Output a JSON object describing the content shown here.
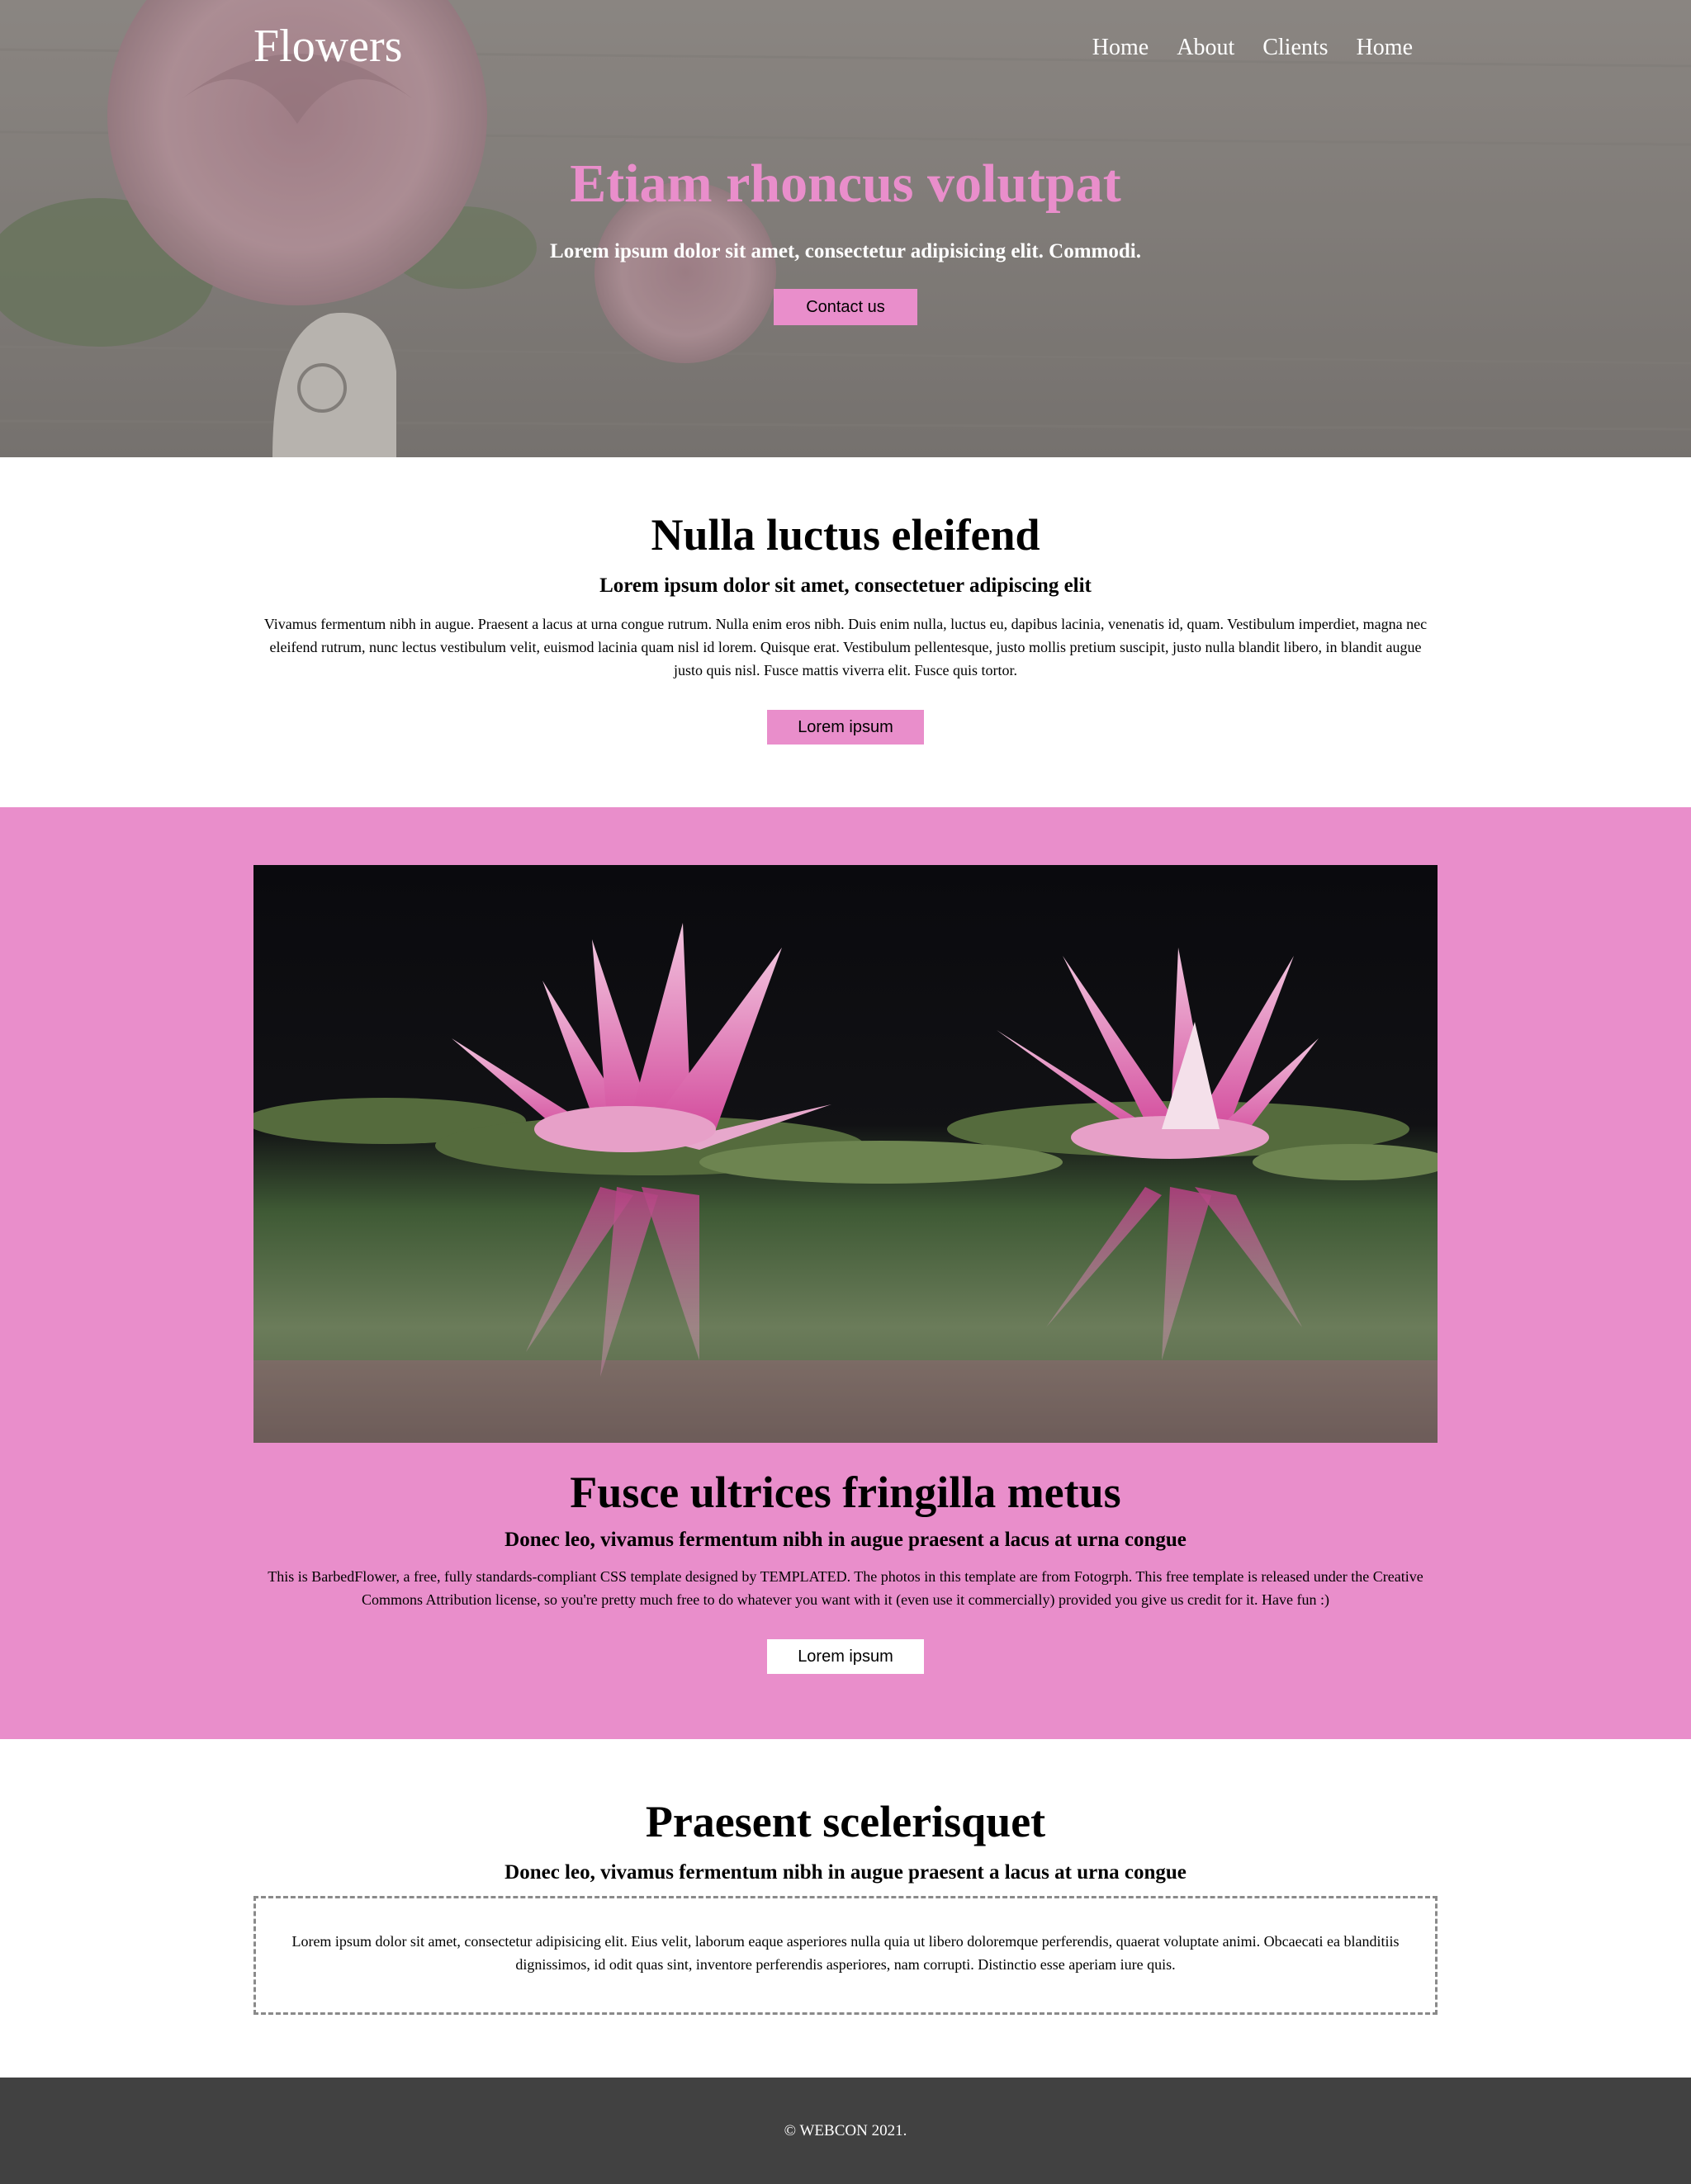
{
  "header": {
    "logo": "Flowers",
    "nav": [
      "Home",
      "About",
      "Clients",
      "Home"
    ]
  },
  "hero": {
    "title": "Etiam rhoncus volutpat",
    "subtitle": "Lorem ipsum dolor sit amet, consectetur adipisicing elit. Commodi.",
    "button": "Contact us"
  },
  "section1": {
    "title": "Nulla luctus eleifend",
    "subtitle": "Lorem ipsum dolor sit amet, consectetuer adipiscing elit",
    "body": "Vivamus fermentum nibh in augue. Praesent a lacus at urna congue rutrum. Nulla enim eros nibh. Duis enim nulla, luctus eu, dapibus lacinia, venenatis id, quam. Vestibulum imperdiet, magna nec eleifend rutrum, nunc lectus vestibulum velit, euismod lacinia quam nisl id lorem. Quisque erat. Vestibulum pellentesque, justo mollis pretium suscipit, justo nulla blandit libero, in blandit augue justo quis nisl. Fusce mattis viverra elit. Fusce quis tortor.",
    "button": "Lorem ipsum"
  },
  "section2": {
    "title": "Fusce ultrices fringilla metus",
    "subtitle": "Donec leo, vivamus fermentum nibh in augue praesent a lacus at urna congue",
    "body": "This is BarbedFlower, a free, fully standards-compliant CSS template designed by TEMPLATED. The photos in this template are from Fotogrph. This free template is released under the Creative Commons Attribution license, so you're pretty much free to do whatever you want with it (even use it commercially) provided you give us credit for it. Have fun :)",
    "button": "Lorem ipsum"
  },
  "section3": {
    "title": "Praesent scelerisquet",
    "subtitle": "Donec leo, vivamus fermentum nibh in augue praesent a lacus at urna congue",
    "body": "Lorem ipsum dolor sit amet, consectetur adipisicing elit. Eius velit, laborum eaque asperiores nulla quia ut libero doloremque perferendis, quaerat voluptate animi. Obcaecati ea blanditiis dignissimos, id odit quas sint, inventore perferendis asperiores, nam corrupti. Distinctio esse aperiam iure quis."
  },
  "footer": {
    "copyright": "© WEBCON 2021."
  },
  "colors": {
    "accent": "#e98ecb",
    "footer_bg": "#414141",
    "text": "#000000"
  }
}
